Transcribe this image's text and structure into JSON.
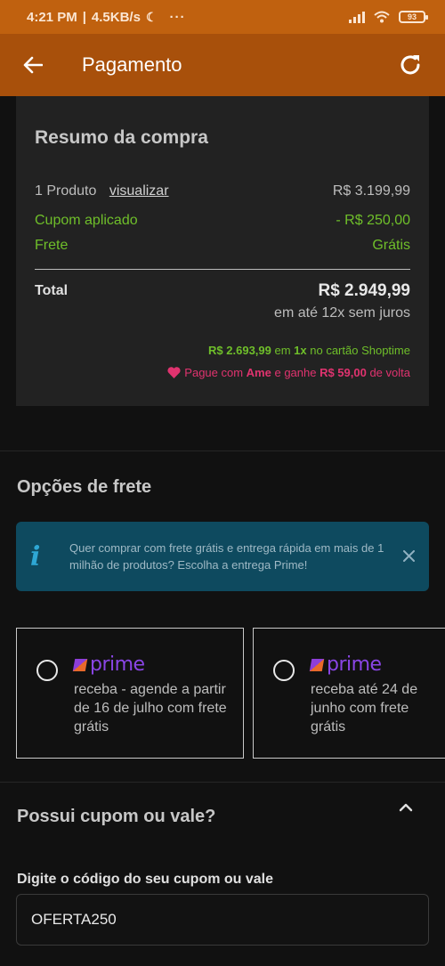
{
  "status_bar": {
    "time": "4:21 PM",
    "net_speed": "4.5KB/s",
    "dots": "···",
    "battery": "93"
  },
  "app_bar": {
    "title": "Pagamento",
    "back_icon": "arrow-left-icon",
    "refresh_icon": "refresh-icon"
  },
  "summary": {
    "title": "Resumo da compra",
    "product_label": "1 Produto",
    "view_link": "visualizar",
    "product_price": "R$ 3.199,99",
    "coupon_label": "Cupom aplicado",
    "coupon_value": "- R$ 250,00",
    "shipping_label": "Frete",
    "shipping_value": "Grátis",
    "total_label": "Total",
    "total_value": "R$ 2.949,99",
    "installments": "em até 12x sem juros",
    "promo_card": {
      "amount": "R$ 2.693,99",
      "text_mid": " em ",
      "times": "1x",
      "text_end": " no cartão Shoptime"
    },
    "promo_ame": {
      "prefix": "Pague com ",
      "brand": "Ame",
      "mid": " e ganhe ",
      "cashback": "R$ 59,00",
      "suffix": " de volta"
    }
  },
  "shipping_options": {
    "title": "Opções de frete",
    "info_text": "Quer comprar com frete grátis e entrega rápida em mais de 1 milhão de produtos? Escolha a entrega Prime!",
    "options": [
      {
        "brand": "prime",
        "description": "receba - agende a partir de 16 de julho com frete grátis",
        "selected": false
      },
      {
        "brand": "prime",
        "description": "receba até 24 de junho com frete grátis",
        "selected": false
      }
    ]
  },
  "coupon": {
    "title": "Possui cupom ou vale?",
    "field_label": "Digite o código do seu cupom ou vale",
    "field_value": "OFERTA250"
  },
  "colors": {
    "status_bar": "#c0610f",
    "app_bar": "#a8500b",
    "green": "#6fbf2a",
    "pink": "#e0336f",
    "prime_purple": "#8a45e6",
    "info_bg": "#0e4a5f"
  }
}
